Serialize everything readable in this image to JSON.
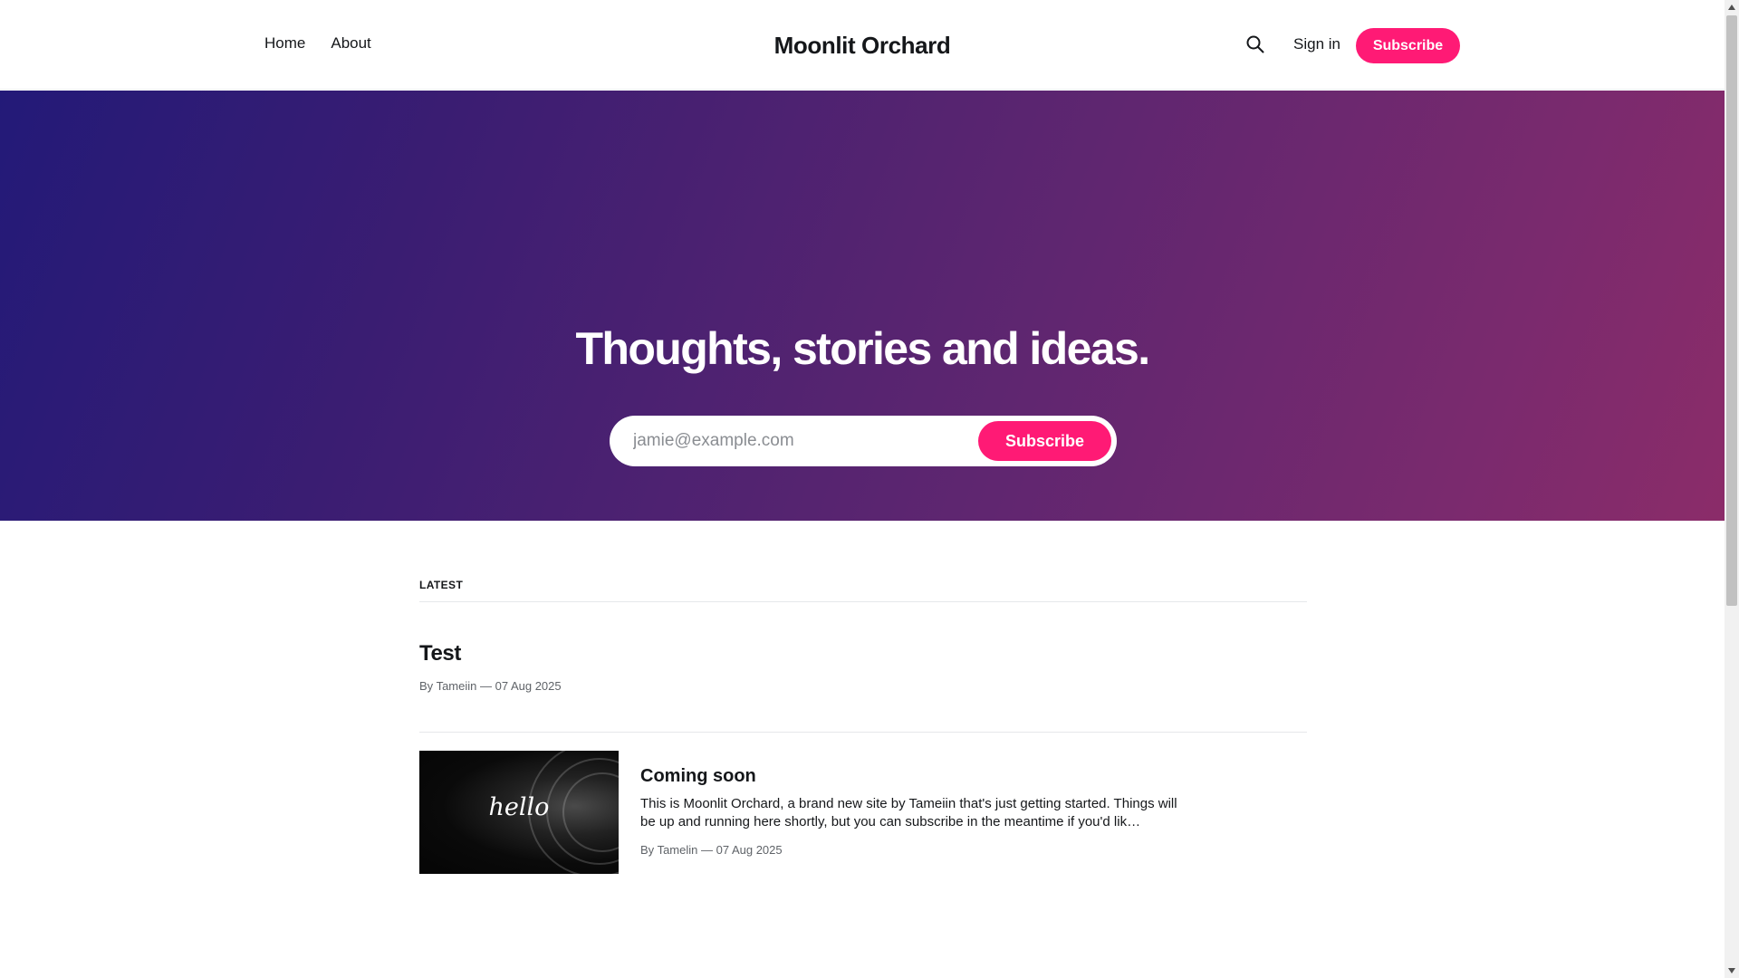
{
  "header": {
    "nav": [
      "Home",
      "About"
    ],
    "site_title": "Moonlit Orchard",
    "sign_in": "Sign in",
    "subscribe": "Subscribe"
  },
  "hero": {
    "title": "Thoughts, stories and ideas.",
    "email_placeholder": "jamie@example.com",
    "subscribe": "Subscribe"
  },
  "feed": {
    "section_label": "LATEST",
    "posts": [
      {
        "title": "Test",
        "author_prefix": "By",
        "author": "Tameiin",
        "date": "07 Aug 2025"
      },
      {
        "title": "Coming soon",
        "excerpt": "This is Moonlit Orchard, a brand new site by Tameiin that's just getting started. Things will be up and running here shortly, but you can subscribe in the meantime if you'd lik…",
        "author_prefix": "By",
        "author": "Tamelin",
        "date": "07 Aug 2025",
        "image_text": "hello"
      }
    ]
  },
  "colors": {
    "accent": "#ff1a75",
    "hero_start": "#231a78",
    "hero_end": "#8b2c69"
  }
}
